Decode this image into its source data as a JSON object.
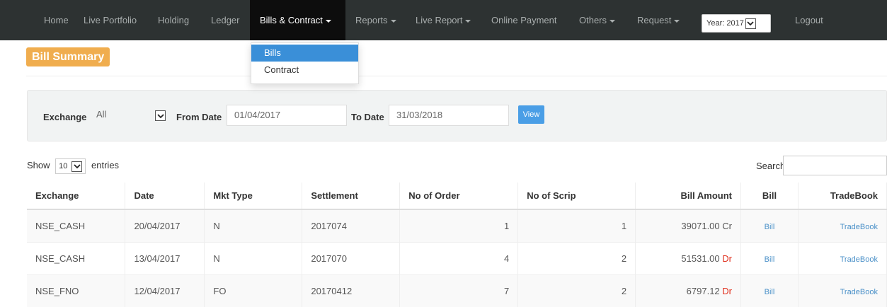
{
  "nav": {
    "home": "Home",
    "live_portfolio": "Live Portfolio",
    "holding": "Holding",
    "ledger": "Ledger",
    "bills_contract": "Bills & Contract",
    "reports": "Reports",
    "live_report": "Live Report",
    "online_payment": "Online Payment",
    "others": "Others",
    "request": "Request",
    "year": "Year: 2017",
    "logout": "Logout"
  },
  "dropdown": {
    "items": [
      "Bills",
      "Contract"
    ]
  },
  "page": {
    "title": "Bill Summary"
  },
  "filter": {
    "exchange_label": "Exchange",
    "exchange_value": "All",
    "from_label": "From Date",
    "from_value": "01/04/2017",
    "to_label": "To Date",
    "to_value": "31/03/2018",
    "view_label": "View"
  },
  "list": {
    "show_label": "Show",
    "entries_value": "10",
    "entries_label": "entries",
    "search_label": "Search:"
  },
  "table": {
    "headers": [
      "Exchange",
      "Date",
      "Mkt Type",
      "Settlement",
      "No of Order",
      "No of Scrip",
      "Bill Amount",
      "Bill",
      "TradeBook"
    ],
    "rows": [
      {
        "exchange": "NSE_CASH",
        "date": "20/04/2017",
        "mkt": "N",
        "settlement": "2017074",
        "orders": "1",
        "scrips": "1",
        "amount": "39071.00",
        "type": "Cr",
        "bill": "Bill",
        "tradebook": "TradeBook"
      },
      {
        "exchange": "NSE_CASH",
        "date": "13/04/2017",
        "mkt": "N",
        "settlement": "2017070",
        "orders": "4",
        "scrips": "2",
        "amount": "51531.00",
        "type": "Dr",
        "bill": "Bill",
        "tradebook": "TradeBook"
      },
      {
        "exchange": "NSE_FNO",
        "date": "12/04/2017",
        "mkt": "FO",
        "settlement": "20170412",
        "orders": "7",
        "scrips": "2",
        "amount": "6797.12",
        "type": "Dr",
        "bill": "Bill",
        "tradebook": "TradeBook"
      }
    ]
  },
  "colors": {
    "navbar": "#2d3232",
    "active_tab": "#0d0d0d",
    "dropdown_selected": "#3a8fd8",
    "bill_summary_badge": "#f0ad4e",
    "view_button": "#4a9ee6",
    "debit": "#e0301e"
  }
}
